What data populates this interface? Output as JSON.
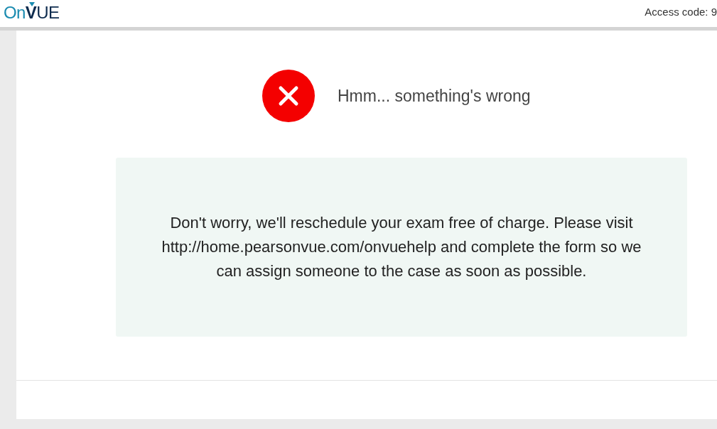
{
  "header": {
    "logo": {
      "prefix": "On",
      "main": "VUE"
    },
    "access_code": "Access code: 9"
  },
  "error": {
    "title": "Hmm... something's wrong",
    "message": "Don't worry, we'll reschedule your exam free of charge. Please visit http://home.pearsonvue.com/onvuehelp and complete the form so we can assign someone to the case as soon as possible."
  }
}
